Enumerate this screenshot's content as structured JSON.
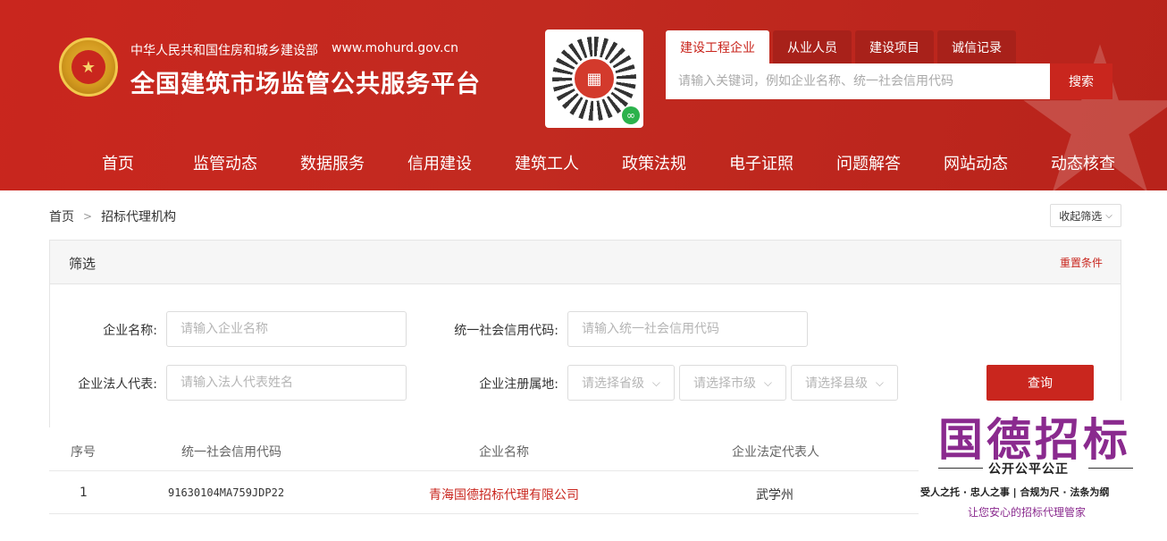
{
  "header": {
    "org_name": "中华人民共和国住房和城乡建设部",
    "org_url": "www.mohurd.gov.cn",
    "site_title": "全国建筑市场监管公共服务平台",
    "emblem_icon": "national-emblem-icon",
    "qr_icon": "qr-code-icon"
  },
  "search": {
    "tabs": [
      "建设工程企业",
      "从业人员",
      "建设项目",
      "诚信记录"
    ],
    "active_tab": 0,
    "placeholder": "请输入关键词，例如企业名称、统一社会信用代码",
    "button_label": "搜索"
  },
  "nav": {
    "items": [
      "首页",
      "监管动态",
      "数据服务",
      "信用建设",
      "建筑工人",
      "政策法规",
      "电子证照",
      "问题解答",
      "网站动态",
      "动态核查"
    ]
  },
  "breadcrumb": {
    "home": "首页",
    "current": "招标代理机构"
  },
  "collapse_label": "收起筛选",
  "filter": {
    "title": "筛选",
    "reset_label": "重置条件",
    "company_name_label": "企业名称:",
    "company_name_placeholder": "请输入企业名称",
    "credit_code_label": "统一社会信用代码:",
    "credit_code_placeholder": "请输入统一社会信用代码",
    "legal_rep_label": "企业法人代表:",
    "legal_rep_placeholder": "请输入法人代表姓名",
    "region_label": "企业注册属地:",
    "province_placeholder": "请选择省级",
    "city_placeholder": "请选择市级",
    "county_placeholder": "请选择县级",
    "query_label": "查询"
  },
  "table": {
    "headers": [
      "序号",
      "统一社会信用代码",
      "企业名称",
      "企业法定代表人"
    ],
    "rows": [
      {
        "index": "1",
        "credit_code": "91630104MA759JDP22",
        "company": "青海国德招标代理有限公司",
        "legal_rep": "武学州"
      }
    ]
  },
  "watermark": {
    "title": "国德招标",
    "subtitle": "公开公平公正",
    "slogan": "受人之托 · 忠人之事 | 合规为尺 · 法条为纲",
    "tagline": "让您安心的招标代理管家"
  },
  "colors": {
    "brand_red": "#c9261e",
    "watermark_purple": "#8a2a8e"
  }
}
